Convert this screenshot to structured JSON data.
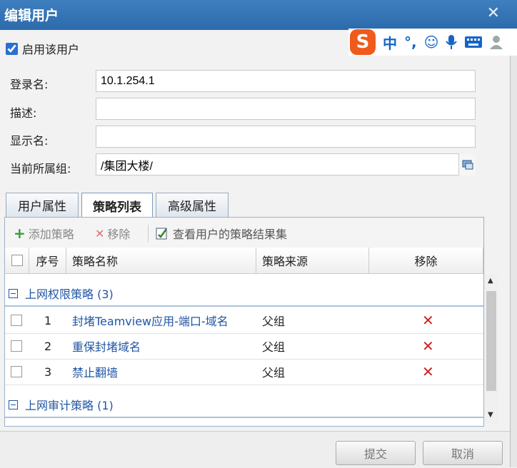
{
  "window": {
    "title": "编辑用户",
    "close": "✕"
  },
  "enable_user": {
    "label": "启用该用户",
    "checked": true
  },
  "ime": {
    "logo": "S",
    "mode": "中",
    "punct": "°,",
    "smile": "☺"
  },
  "form": {
    "login_label": "登录名:",
    "login_value": "10.1.254.1",
    "desc_label": "描述:",
    "desc_value": "",
    "display_label": "显示名:",
    "display_value": "",
    "group_label": "当前所属组:",
    "group_value": "/集团大楼/"
  },
  "tabs": [
    {
      "label": "用户属性",
      "active": false
    },
    {
      "label": "策略列表",
      "active": true
    },
    {
      "label": "高级属性",
      "active": false
    }
  ],
  "toolbar": {
    "add": "添加策略",
    "remove": "移除",
    "view": "查看用户的策略结果集"
  },
  "grid": {
    "columns": [
      "序号",
      "策略名称",
      "策略来源",
      "移除"
    ],
    "groups": [
      {
        "title": "上网权限策略 (3)",
        "rows": [
          {
            "no": "1",
            "name": "封堵Teamview应用-端口-域名",
            "source": "父组"
          },
          {
            "no": "2",
            "name": "重保封堵域名",
            "source": "父组"
          },
          {
            "no": "3",
            "name": "禁止翻墙",
            "source": "父组"
          }
        ]
      },
      {
        "title": "上网审计策略 (1)",
        "rows": []
      }
    ]
  },
  "footer": {
    "submit": "提交",
    "cancel": "取消"
  },
  "colors": {
    "titlebar": "#2c6aab",
    "link": "#2056a4",
    "delete": "#d21f1f"
  }
}
